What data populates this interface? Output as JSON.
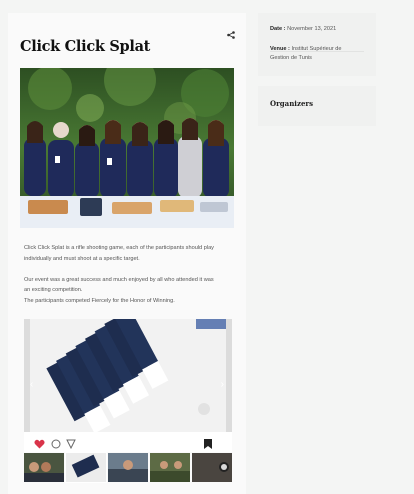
{
  "event": {
    "title": "Click Click Splat",
    "description": [
      "Click Click Splat is a rifle shooting game, each of the participants should play",
      "individually and must shoot at a specific target.",
      "",
      "Our event was a great success and much enjoyed by all who attended it was",
      "an exciting competition.",
      "The participants competed Fiercely for the Honor of Winning."
    ]
  },
  "sidebar": {
    "date_label": "Date :",
    "date_value": "November 13, 2021",
    "venue_label": "Venue :",
    "venue_value_line1": "Institut Supérieur de",
    "venue_value_line2": "Gestion de Tunis",
    "organizers_title": "Organizers"
  },
  "icons": {
    "share": "share-icon",
    "like": "heart-icon",
    "comment": "comment-icon",
    "send": "send-icon",
    "save": "bookmark-icon",
    "carousel_prev": "chevron-left-icon",
    "carousel_next": "chevron-right-icon"
  },
  "colors": {
    "heart": "#d9344a",
    "ticket": "#1e2d4f",
    "jacket": "#1f2a5a"
  }
}
